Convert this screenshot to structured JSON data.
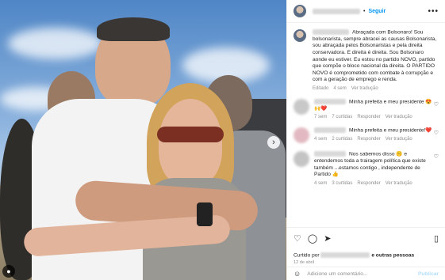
{
  "header": {
    "follow_label": "Seguir",
    "separator": "•",
    "more_icon": "more-horizontal-icon"
  },
  "caption": {
    "text": "Abraçada com Bolsonaro! Sou bolsonarista, sempre abracei as causas Bolsonarista, sou abraçada pelos Bolsonaristas e pela direita conservadora. E direita é direita. Sou Bolsonaro aonde eu estiver. Eu estou no partido NOVO, partido que compõe o bloco nacional da direita. O PARTIDO NOVO é comprometido com combate à corrupção e com a geração de emprego e renda.",
    "edited": "Editado",
    "time": "4 sem",
    "translate": "Ver tradução"
  },
  "comments": [
    {
      "text": "Minha prefeita e meu presidente 😍🙌❤️",
      "time": "7 sem",
      "likes": "7 curtidas",
      "reply": "Responder",
      "translate": "Ver tradução",
      "avatar_color": "#c8c8c8"
    },
    {
      "text": "Minha prefeita e meu presidente!❤️",
      "time": "4 sem",
      "likes": "2 curtidas",
      "reply": "Responder",
      "translate": "Ver tradução",
      "avatar_color": "#e2b9c2"
    },
    {
      "text": "Nos sabemos disso 🤫 e entendemos toda a trairagem política que existe também ...estamos contigo , independente de Partido 👍",
      "time": "4 sem",
      "likes": "3 curtidas",
      "reply": "Responder",
      "translate": "Ver tradução",
      "avatar_color": "#c4c4c4"
    }
  ],
  "footer": {
    "liked_prefix": "Curtido por",
    "liked_suffix": "e outras pessoas",
    "date": "12 de abril",
    "comment_placeholder": "Adicione um comentário...",
    "publish_label": "Publicar"
  },
  "colors": {
    "accent": "#0095f6",
    "muted": "#8e8e8e",
    "text": "#262626"
  }
}
